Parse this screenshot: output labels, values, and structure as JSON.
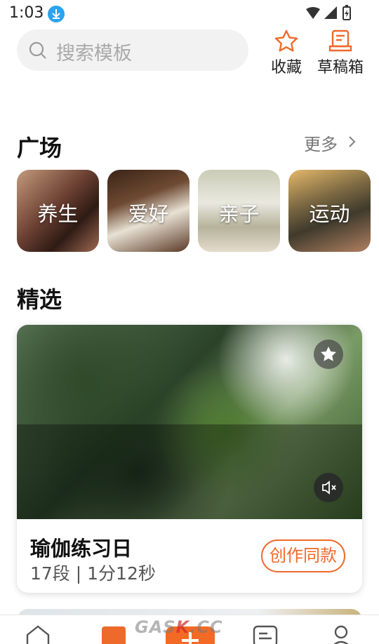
{
  "status_bar": {
    "time": "1:03"
  },
  "search": {
    "placeholder": "搜索模板"
  },
  "top_actions": {
    "favorites_label": "收藏",
    "drafts_label": "草稿箱"
  },
  "plaza": {
    "title": "广场",
    "more_label": "更多",
    "categories": [
      {
        "label": "养生"
      },
      {
        "label": "爱好"
      },
      {
        "label": "亲子"
      },
      {
        "label": "运动"
      }
    ]
  },
  "featured": {
    "title": "精选",
    "card": {
      "title": "瑜伽练习日",
      "meta": "17段 | 1分12秒",
      "create_label": "创作同款"
    }
  },
  "watermark": {
    "text_a": "GAS",
    "text_b": "K",
    "text_c": ".CC"
  },
  "colors": {
    "accent": "#ee6a2a",
    "download_badge": "#2aa3f0"
  }
}
